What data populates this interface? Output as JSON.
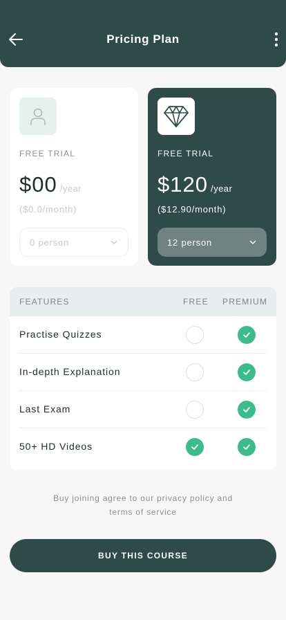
{
  "header": {
    "title": "Pricing Plan",
    "back_icon": "arrow-left-icon",
    "more_icon": "more-vertical-icon"
  },
  "plans": [
    {
      "id": "free",
      "icon": "user-icon",
      "label": "FREE TRIAL",
      "price": "$00",
      "period": "/year",
      "monthly": "($0.0/month)",
      "select_value": "0 person"
    },
    {
      "id": "premium",
      "icon": "diamond-icon",
      "label": "FREE TRIAL",
      "price": "$120",
      "period": "/year",
      "monthly": "($12.90/month)",
      "select_value": "12 person"
    }
  ],
  "features": {
    "header": {
      "label": "FEATURES",
      "free": "FREE",
      "premium": "PREMIUM"
    },
    "rows": [
      {
        "name": "Practise Quizzes",
        "free": false,
        "premium": true
      },
      {
        "name": "In-depth Explanation",
        "free": false,
        "premium": true
      },
      {
        "name": "Last Exam",
        "free": false,
        "premium": true
      },
      {
        "name": "50+ HD Videos",
        "free": true,
        "premium": true
      }
    ]
  },
  "terms": {
    "line1": "Buy joining agree to our privacy policy and",
    "line2": "terms of service"
  },
  "cta": {
    "label": "BUY THIS COURSE"
  },
  "colors": {
    "primary": "#2f4b47",
    "accent": "#3dbb8d",
    "background": "#f7f7f7"
  }
}
